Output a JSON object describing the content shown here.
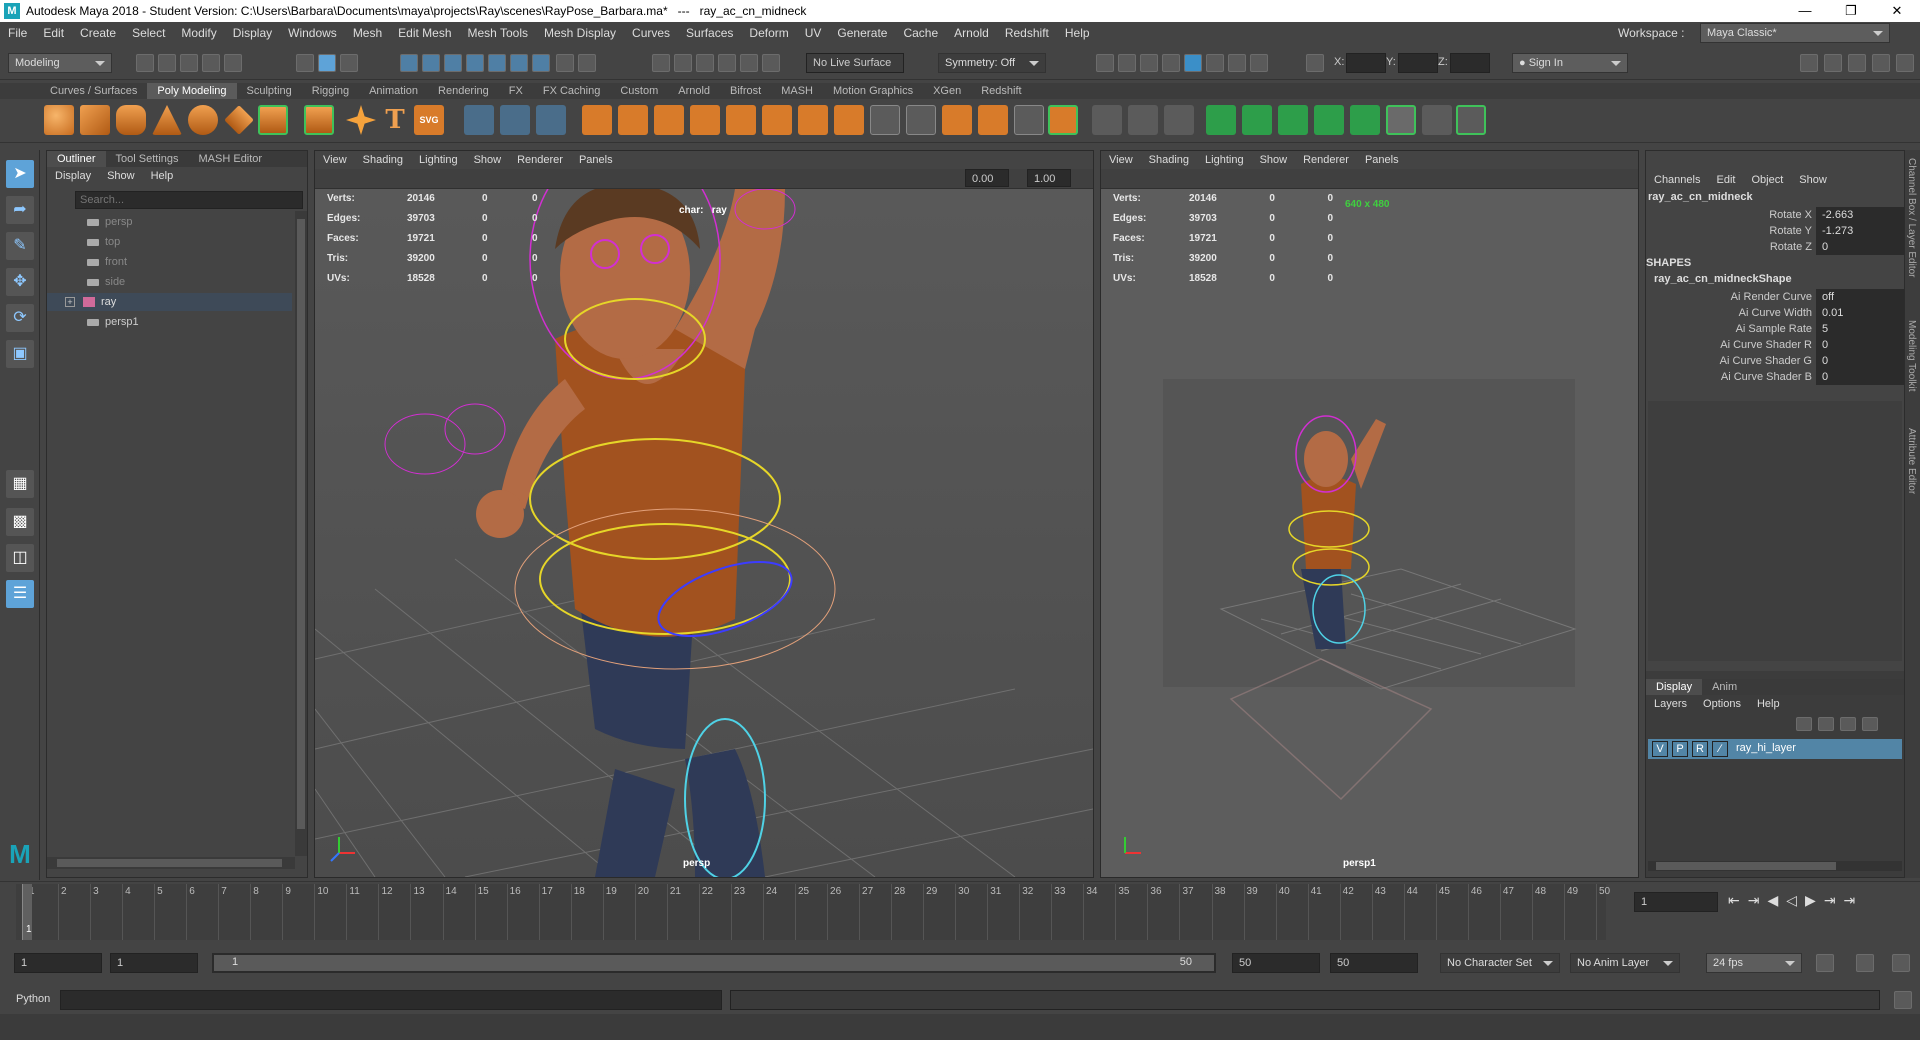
{
  "window": {
    "title": "Autodesk Maya 2018 - Student Version: C:\\Users\\Barbara\\Documents\\maya\\projects\\Ray\\scenes\\RayPose_Barbara.ma*   ---   ray_ac_cn_midneck",
    "minimize": "—",
    "maximize": "❐",
    "close": "✕"
  },
  "menubar": [
    "File",
    "Edit",
    "Create",
    "Select",
    "Modify",
    "Display",
    "Windows",
    "Mesh",
    "Edit Mesh",
    "Mesh Tools",
    "Mesh Display",
    "Curves",
    "Surfaces",
    "Deform",
    "UV",
    "Generate",
    "Cache",
    "Arnold",
    "Redshift",
    "Help"
  ],
  "workspace": {
    "label": "Workspace :",
    "value": "Maya Classic*"
  },
  "statusline": {
    "mode": "Modeling",
    "live_surface": "No Live Surface",
    "symmetry": "Symmetry: Off",
    "x_label": "X:",
    "y_label": "Y:",
    "z_label": "Z:",
    "sign_in": "Sign In"
  },
  "shelf_tabs": [
    "Curves / Surfaces",
    "Poly Modeling",
    "Sculpting",
    "Rigging",
    "Animation",
    "Rendering",
    "FX",
    "FX Caching",
    "Custom",
    "Arnold",
    "Bifrost",
    "MASH",
    "Motion Graphics",
    "XGen",
    "Redshift"
  ],
  "shelf_active": "Poly Modeling",
  "shelf_text_icons": {
    "text": "T",
    "svg": "SVG"
  },
  "outliner": {
    "tabs": [
      "Outliner",
      "Tool Settings",
      "MASH Editor"
    ],
    "menu": [
      "Display",
      "Show",
      "Help"
    ],
    "search_placeholder": "Search...",
    "items": [
      {
        "name": "persp",
        "type": "camera"
      },
      {
        "name": "top",
        "type": "camera"
      },
      {
        "name": "front",
        "type": "camera"
      },
      {
        "name": "side",
        "type": "camera"
      },
      {
        "name": "ray",
        "type": "group"
      },
      {
        "name": "persp1",
        "type": "camera"
      }
    ],
    "selected": "ray"
  },
  "viewport_menu": [
    "View",
    "Shading",
    "Lighting",
    "Show",
    "Renderer",
    "Panels"
  ],
  "viewport1": {
    "camera": "persp",
    "exposure": "0.00",
    "gamma": "1.00",
    "char_label": "char:",
    "char_value": "ray"
  },
  "viewport2": {
    "camera": "persp1",
    "resolution": "640 x 480"
  },
  "hud": [
    {
      "label": "Verts:",
      "value": "20146",
      "a": "0",
      "b": "0"
    },
    {
      "label": "Edges:",
      "value": "39703",
      "a": "0",
      "b": "0"
    },
    {
      "label": "Faces:",
      "value": "19721",
      "a": "0",
      "b": "0"
    },
    {
      "label": "Tris:",
      "value": "39200",
      "a": "0",
      "b": "0"
    },
    {
      "label": "UVs:",
      "value": "18528",
      "a": "0",
      "b": "0"
    }
  ],
  "channelbox": {
    "menu": [
      "Channels",
      "Edit",
      "Object",
      "Show"
    ],
    "object": "ray_ac_cn_midneck",
    "attrs": [
      {
        "label": "Rotate X",
        "value": "-2.663"
      },
      {
        "label": "Rotate Y",
        "value": "-1.273"
      },
      {
        "label": "Rotate Z",
        "value": "0"
      }
    ],
    "shapes_header": "SHAPES",
    "shape_name": "ray_ac_cn_midneckShape",
    "shape_attrs": [
      {
        "label": "Ai Render Curve",
        "value": "off"
      },
      {
        "label": "Ai Curve Width",
        "value": "0.01"
      },
      {
        "label": "Ai Sample Rate",
        "value": "5"
      },
      {
        "label": "Ai Curve Shader R",
        "value": "0"
      },
      {
        "label": "Ai Curve Shader G",
        "value": "0"
      },
      {
        "label": "Ai Curve Shader B",
        "value": "0"
      }
    ]
  },
  "layer_editor": {
    "tabs": [
      "Display",
      "Anim"
    ],
    "menu": [
      "Layers",
      "Options",
      "Help"
    ],
    "layer": {
      "v": "V",
      "p": "P",
      "r": "R",
      "name": "ray_hi_layer"
    }
  },
  "side_tabs": [
    "Channel Box / Layer Editor",
    "Modeling Toolkit",
    "Attribute Editor"
  ],
  "timeline": {
    "ticks": [
      1,
      2,
      3,
      4,
      5,
      6,
      7,
      8,
      9,
      10,
      11,
      12,
      13,
      14,
      15,
      16,
      17,
      18,
      19,
      20,
      21,
      22,
      23,
      24,
      25,
      26,
      27,
      28,
      29,
      30,
      31,
      32,
      33,
      34,
      35,
      36,
      37,
      38,
      39,
      40,
      41,
      42,
      43,
      44,
      45,
      46,
      47,
      48,
      49,
      50
    ],
    "current_frame": "1",
    "frame_field": "1"
  },
  "range": {
    "start": "1",
    "start_inner": "1",
    "slider_left": "1",
    "slider_right": "50",
    "end_inner": "50",
    "end": "50",
    "char_set": "No Character Set",
    "anim_layer": "No Anim Layer",
    "fps": "24 fps"
  },
  "cmdline": {
    "label": "Python"
  },
  "colors": {
    "accent": "#5ea3d8",
    "shirt": "#a2521f",
    "jeans": "#2f3a57",
    "control_magenta": "#d22fd2",
    "control_yellow": "#e6d628",
    "control_cyan": "#4fd2e6"
  }
}
